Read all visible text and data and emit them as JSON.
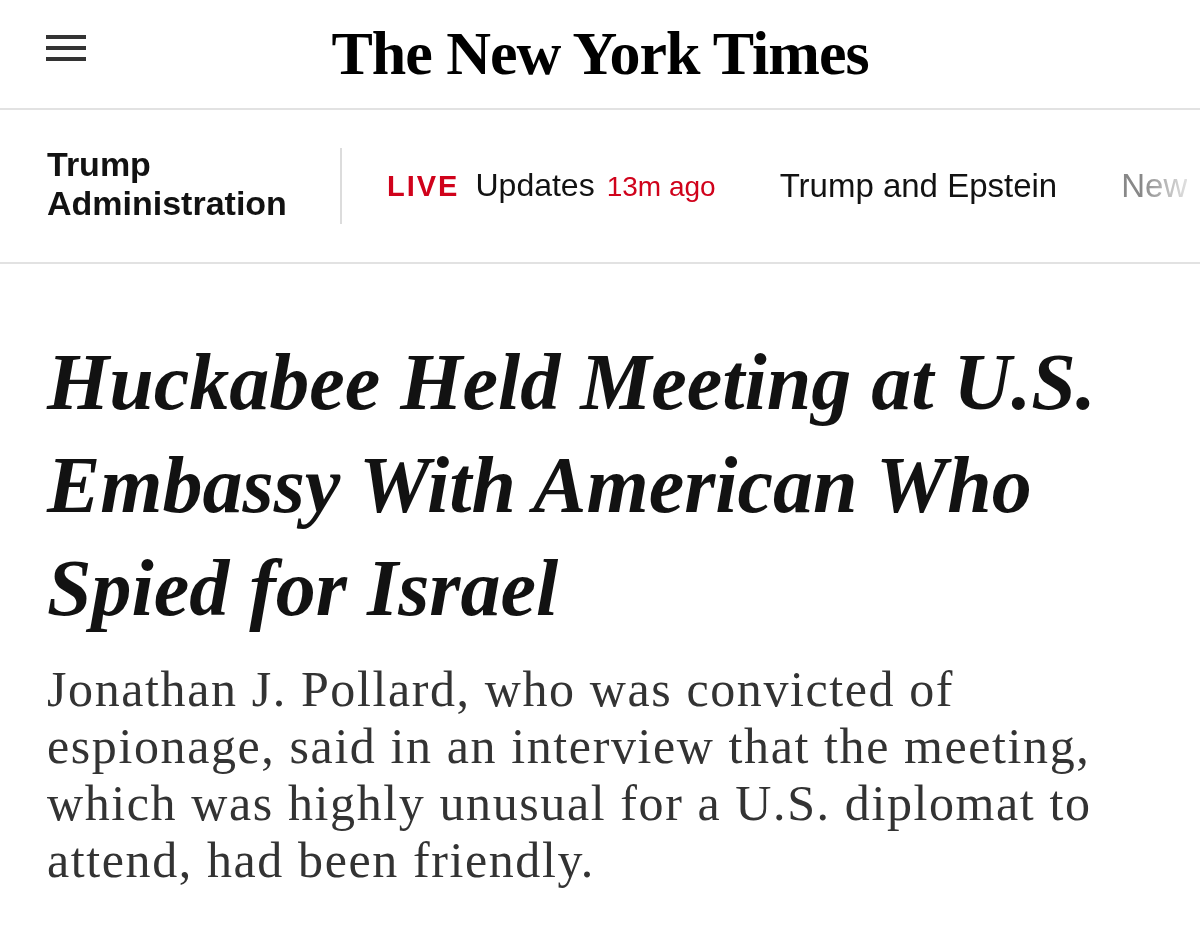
{
  "masthead": {
    "title": "The New York Times"
  },
  "section_bar": {
    "section": "Trump Administration",
    "links": [
      {
        "kind": "live",
        "badge": "LIVE",
        "label": "Updates",
        "time": "13m ago"
      },
      {
        "kind": "link",
        "label": "Trump and Epstein"
      },
      {
        "kind": "link",
        "label": "New"
      }
    ]
  },
  "article": {
    "headline": "Huckabee Held Meeting at U.S. Embassy With American Who Spied for Israel",
    "summary": "Jonathan J. Pollard, who was convicted of espionage, said in an interview that the meeting, which was highly unusual for a U.S. diplomat to attend, had been friendly."
  }
}
